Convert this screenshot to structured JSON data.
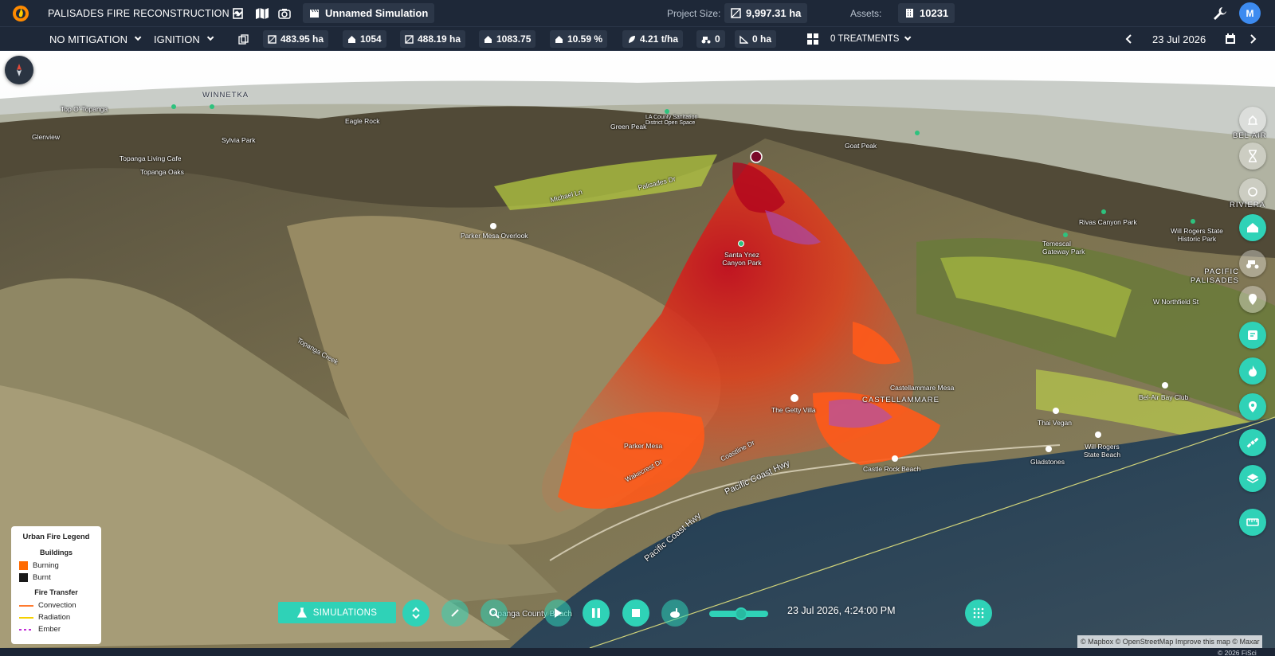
{
  "topbar": {
    "project_title": "PALISADES FIRE RECONSTRUCTION",
    "simulation_name": "Unnamed Simulation",
    "project_size_label": "Project Size:",
    "project_size_value": "9,997.31 ha",
    "assets_label": "Assets:",
    "assets_value": "10231",
    "avatar_initial": "M",
    "icons": [
      "app-logo-icon",
      "sign-in-icon",
      "map-book-icon",
      "camera-icon",
      "clapper-icon",
      "area-icon",
      "building-icon",
      "wrench-icon"
    ]
  },
  "toolbar": {
    "mitigation": "NO MITIGATION",
    "ignition": "IGNITION",
    "stats": [
      {
        "icon": "area-icon",
        "value": "483.95 ha"
      },
      {
        "icon": "house-icon",
        "value": "1054"
      },
      {
        "icon": "area-icon",
        "value": "488.19 ha"
      },
      {
        "icon": "house-icon",
        "value": "1083.75"
      },
      {
        "icon": "house-icon",
        "value": "10.59 %"
      },
      {
        "icon": "leaf-icon",
        "value": "4.21 t/ha"
      },
      {
        "icon": "tractor-icon",
        "value": "0"
      },
      {
        "icon": "slope-icon",
        "value": "0 ha"
      }
    ],
    "treatments": "0 TREATMENTS",
    "date": "23 Jul 2026"
  },
  "map": {
    "labels": [
      {
        "text": "WINNETKA",
        "cls": "big"
      },
      {
        "text": "Top O' Topanga"
      },
      {
        "text": "Eagle Rock"
      },
      {
        "text": "Glenview"
      },
      {
        "text": "Sylvia Park"
      },
      {
        "text": "Topanga Living Cafe"
      },
      {
        "text": "Topanga Oaks"
      },
      {
        "text": "Green Peak"
      },
      {
        "text": "LA County Sanitation District Open Space"
      },
      {
        "text": "Goat Peak"
      },
      {
        "text": "Palisades Dr"
      },
      {
        "text": "Michael Ln"
      },
      {
        "text": "Parker Mesa Overlook"
      },
      {
        "text": "Santa Ynez Canyon Park"
      },
      {
        "text": "Temescal Gateway Park"
      },
      {
        "text": "Rivas Canyon Park"
      },
      {
        "text": "Will Rogers State Historic Park"
      },
      {
        "text": "PACIFIC PALISADES",
        "cls": "big"
      },
      {
        "text": "W Northfield St"
      },
      {
        "text": "Castellammare Mesa"
      },
      {
        "text": "CASTELLAMMARE",
        "cls": "big"
      },
      {
        "text": "The Getty Villa"
      },
      {
        "text": "Parker Mesa"
      },
      {
        "text": "Coastline Dr"
      },
      {
        "text": "Wakecrest Dr"
      },
      {
        "text": "Pacific Coast Hwy"
      },
      {
        "text": "Pacific Coast Hwy"
      },
      {
        "text": "Castle Rock Beach"
      },
      {
        "text": "Gladstones"
      },
      {
        "text": "Will Rogers State Beach"
      },
      {
        "text": "Thai Vegan"
      },
      {
        "text": "Bel-Air Bay Club"
      },
      {
        "text": "Topanga County Beach"
      },
      {
        "text": "Topanga Creek"
      },
      {
        "text": "BEL AIR",
        "cls": "big"
      },
      {
        "text": "RIVIERA",
        "cls": "big"
      }
    ],
    "attribution": "© Mapbox © OpenStreetMap  Improve this map © Maxar",
    "copyright": "© 2026 FiSci"
  },
  "legend": {
    "title": "Urban Fire Legend",
    "buildings_title": "Buildings",
    "buildings": [
      {
        "label": "Burning",
        "color": "#ff6a00"
      },
      {
        "label": "Burnt",
        "color": "#1a1a1a"
      }
    ],
    "transfer_title": "Fire Transfer",
    "transfer": [
      {
        "label": "Convection",
        "color": "#ff7a2f",
        "style": "solid"
      },
      {
        "label": "Radiation",
        "color": "#f5d000",
        "style": "solid"
      },
      {
        "label": "Ember",
        "color": "#c02cd6",
        "style": "dashed"
      }
    ]
  },
  "right_tools": [
    "fire-station-icon",
    "hourglass-icon",
    "layer-tool-icon",
    "home-icon",
    "tractor-icon",
    "marker-icon",
    "note-icon",
    "flame-icon",
    "location-pin-icon",
    "satellite-icon",
    "layers-icon",
    "ruler-icon"
  ],
  "controls": {
    "simulations_label": "SIMULATIONS",
    "sim_time": "23 Jul 2026, 4:24:00 PM",
    "speed_level": 0.55
  },
  "colors": {
    "accent": "#2fd2b7",
    "topbar": "#1e2838",
    "fire": "#e8401c"
  }
}
